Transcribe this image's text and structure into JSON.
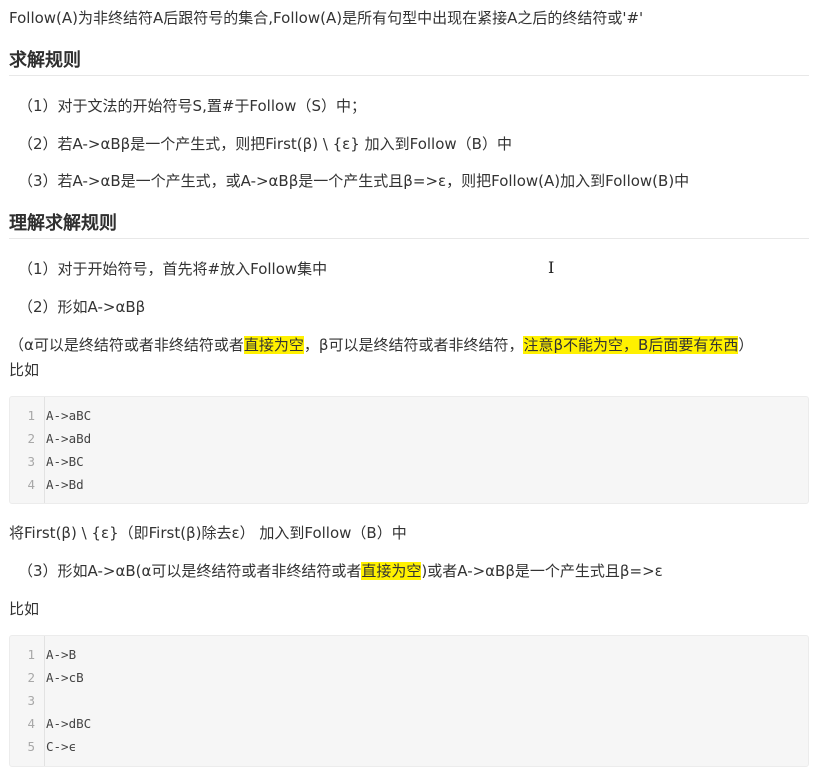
{
  "intro": "Follow(A)为非终结符A后跟符号的集合,Follow(A)是所有句型中出现在紧接A之后的终结符或'#'",
  "section1": {
    "title": "求解规则",
    "items": [
      "（1）对于文法的开始符号S,置#于Follow（S）中；",
      "（2）若A->αBβ是一个产生式，则把First(β) \\ {ε} 加入到Follow（B）中",
      "（3）若A->αB是一个产生式，或A->αBβ是一个产生式且β=>ε，则把Follow(A)加入到Follow(B)中"
    ]
  },
  "section2": {
    "title": "理解求解规则",
    "item1": "（1）对于开始符号，首先将#放入Follow集中",
    "item2": "（2）形如A->αBβ",
    "note": {
      "p1": "（α可以是终结符或者非终结符或者",
      "h1": "直接为空",
      "p2": "，β可以是终结符或者非终结符，",
      "h2": "注意β不能为空，B后面要有东西",
      "p3": "）"
    },
    "example_label1": "比如",
    "code1": [
      {
        "n": "1",
        "t": "A->aBC"
      },
      {
        "n": "2",
        "t": "A->aBd"
      },
      {
        "n": "3",
        "t": "A->BC"
      },
      {
        "n": "4",
        "t": "A->Bd"
      }
    ],
    "after_code1": "将First(β) \\ {ε}（即First(β)除去ε） 加入到Follow（B）中",
    "item3": {
      "p1": "（3）形如A->αB(α可以是终结符或者非终结符或者",
      "h1": "直接为空",
      "p2": ")或者A->αBβ是一个产生式且β=>ε"
    },
    "example_label2": "比如",
    "code2": [
      {
        "n": "1",
        "t": "A->B"
      },
      {
        "n": "2",
        "t": "A->cB"
      },
      {
        "n": "3",
        "t": ""
      },
      {
        "n": "4",
        "t": "A->dBC"
      },
      {
        "n": "5",
        "t": "C->ϵ"
      }
    ]
  },
  "cursor_glyph": "I"
}
